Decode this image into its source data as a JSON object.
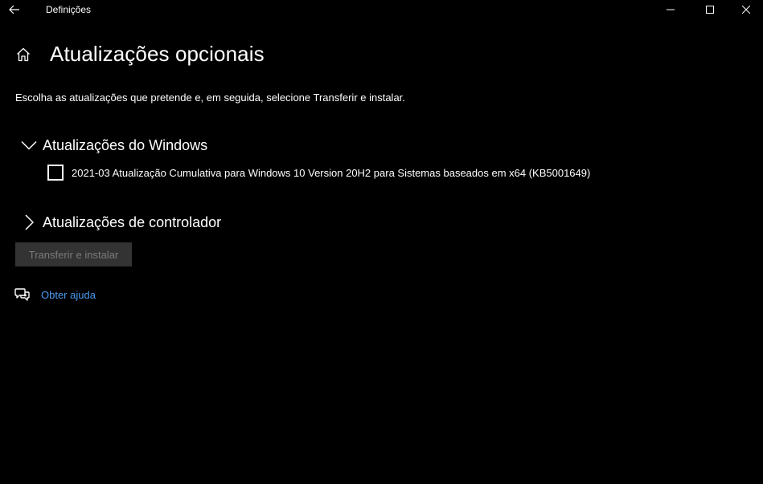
{
  "titlebar": {
    "app_title": "Definições",
    "back_icon": "arrow-left-icon",
    "controls": [
      "minimize-icon",
      "maximize-icon",
      "close-icon"
    ]
  },
  "header": {
    "home_icon": "home-icon",
    "title": "Atualizações opcionais"
  },
  "description": "Escolha as atualizações que pretende e, em seguida, selecione Transferir e instalar.",
  "sections": {
    "windows_updates": {
      "label": "Atualizações do Windows",
      "expanded": true,
      "items": [
        {
          "label": "2021-03 Atualização Cumulativa para Windows 10 Version 20H2 para Sistemas baseados em x64 (KB5001649)",
          "checked": false
        }
      ]
    },
    "driver_updates": {
      "label": "Atualizações de controlador",
      "expanded": false
    }
  },
  "actions": {
    "install_label": "Transferir e instalar",
    "install_enabled": false
  },
  "help": {
    "icon": "chat-help-icon",
    "link_label": "Obter ajuda"
  },
  "colors": {
    "background": "#000000",
    "text": "#ffffff",
    "link": "#4c9bf0",
    "button_disabled_bg": "#333333",
    "button_disabled_text": "#7a7a7a"
  }
}
